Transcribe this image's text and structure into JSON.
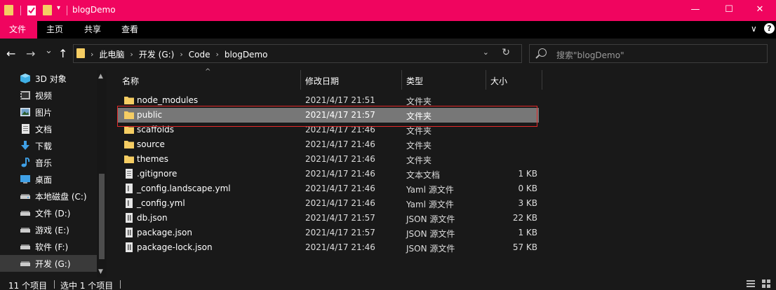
{
  "window": {
    "title": "blogDemo",
    "minimize_glyph": "—",
    "maximize_glyph": "☐",
    "close_glyph": "✕",
    "qa_dropdown_glyph": "▾"
  },
  "colors": {
    "accent": "#f0055f",
    "folder": "#f5cd63",
    "selection": "#777777",
    "focus_outline": "#e32a2a"
  },
  "ribbon": {
    "tabs": [
      {
        "label": "文件"
      },
      {
        "label": "主页"
      },
      {
        "label": "共享"
      },
      {
        "label": "查看"
      }
    ],
    "expand_glyph": "∨",
    "help_glyph": "?"
  },
  "nav": {
    "back_glyph": "←",
    "forward_glyph": "→",
    "recent_glyph": "⌄",
    "up_glyph": "↑",
    "breadcrumb": [
      {
        "label": "此电脑"
      },
      {
        "label": "开发 (G:)"
      },
      {
        "label": "Code"
      },
      {
        "label": "blogDemo"
      }
    ],
    "breadcrumb_sep": "›",
    "dropdown_glyph": "⌄",
    "refresh_glyph": "↻"
  },
  "search": {
    "placeholder": "搜索\"blogDemo\""
  },
  "sidebar": {
    "items": [
      {
        "label": "3D 对象",
        "icon": "cube-icon"
      },
      {
        "label": "视频",
        "icon": "video-icon"
      },
      {
        "label": "图片",
        "icon": "picture-icon"
      },
      {
        "label": "文档",
        "icon": "document-icon"
      },
      {
        "label": "下载",
        "icon": "download-icon"
      },
      {
        "label": "音乐",
        "icon": "music-icon"
      },
      {
        "label": "桌面",
        "icon": "desktop-icon"
      },
      {
        "label": "本地磁盘 (C:)",
        "icon": "drive-icon"
      },
      {
        "label": "文件 (D:)",
        "icon": "drive-icon"
      },
      {
        "label": "游戏 (E:)",
        "icon": "drive-icon"
      },
      {
        "label": "软件 (F:)",
        "icon": "drive-icon"
      },
      {
        "label": "开发 (G:)",
        "icon": "drive-icon",
        "selected": true
      }
    ],
    "scroll_up_glyph": "▲",
    "scroll_down_glyph": "▼"
  },
  "table": {
    "sort_glyph": "^",
    "columns": {
      "name": "名称",
      "date": "修改日期",
      "type": "类型",
      "size": "大小"
    },
    "rows": [
      {
        "name": "node_modules",
        "date": "2021/4/17 21:51",
        "type": "文件夹",
        "size": "",
        "icon": "folder-icon"
      },
      {
        "name": "public",
        "date": "2021/4/17 21:57",
        "type": "文件夹",
        "size": "",
        "icon": "folder-icon",
        "selected": true
      },
      {
        "name": "scaffolds",
        "date": "2021/4/17 21:46",
        "type": "文件夹",
        "size": "",
        "icon": "folder-icon"
      },
      {
        "name": "source",
        "date": "2021/4/17 21:46",
        "type": "文件夹",
        "size": "",
        "icon": "folder-icon"
      },
      {
        "name": "themes",
        "date": "2021/4/17 21:46",
        "type": "文件夹",
        "size": "",
        "icon": "folder-icon"
      },
      {
        "name": ".gitignore",
        "date": "2021/4/17 21:46",
        "type": "文本文档",
        "size": "1 KB",
        "icon": "text-file-icon"
      },
      {
        "name": "_config.landscape.yml",
        "date": "2021/4/17 21:46",
        "type": "Yaml 源文件",
        "size": "0 KB",
        "icon": "yaml-file-icon"
      },
      {
        "name": "_config.yml",
        "date": "2021/4/17 21:46",
        "type": "Yaml 源文件",
        "size": "3 KB",
        "icon": "yaml-file-icon"
      },
      {
        "name": "db.json",
        "date": "2021/4/17 21:57",
        "type": "JSON 源文件",
        "size": "22 KB",
        "icon": "json-file-icon"
      },
      {
        "name": "package.json",
        "date": "2021/4/17 21:57",
        "type": "JSON 源文件",
        "size": "1 KB",
        "icon": "json-file-icon"
      },
      {
        "name": "package-lock.json",
        "date": "2021/4/17 21:46",
        "type": "JSON 源文件",
        "size": "57 KB",
        "icon": "json-file-icon"
      }
    ]
  },
  "status": {
    "item_count": "11 个项目",
    "selected_count": "选中 1 个项目"
  }
}
